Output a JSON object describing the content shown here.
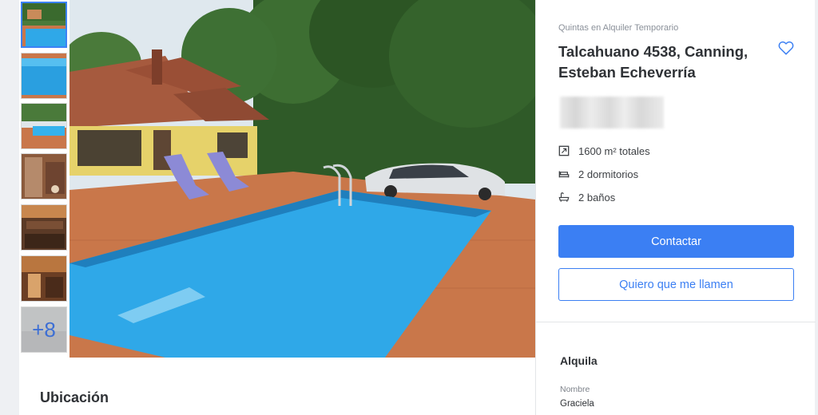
{
  "gallery": {
    "more_label": "+8",
    "thumbnails": [
      "pool-thumb-1",
      "pool-thumb-2",
      "pool-thumb-3",
      "interior-thumb-1",
      "interior-thumb-2",
      "interior-thumb-3",
      "more-thumb"
    ]
  },
  "main": {
    "section_title": "Ubicación"
  },
  "listing": {
    "type": "Quintas en Alquiler Temporario",
    "title_line1": "Talcahuano 4538, Canning,",
    "title_line2": "Esteban Echeverría",
    "features": {
      "area": "1600 m² totales",
      "bedrooms": "2 dormitorios",
      "bathrooms": "2 baños"
    },
    "contact_button": "Contactar",
    "callback_button": "Quiero que me llamen"
  },
  "owner": {
    "section_title": "Alquila",
    "name_label": "Nombre",
    "name_value": "Graciela"
  },
  "colors": {
    "accent": "#3b7ff3",
    "pool": "#2fa8e8",
    "deck": "#c9774a"
  }
}
